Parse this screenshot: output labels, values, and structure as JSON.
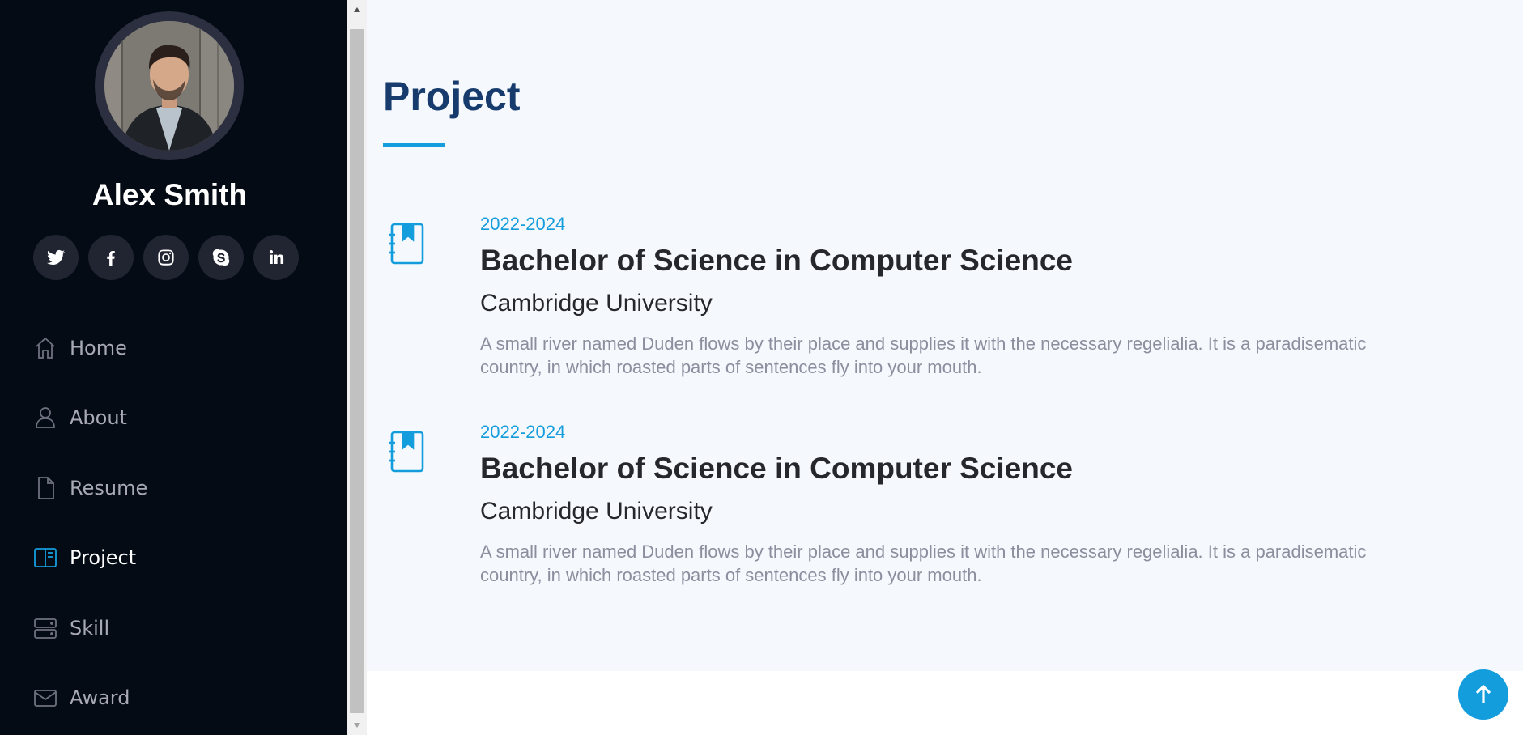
{
  "profile": {
    "name": "Alex Smith"
  },
  "social": [
    {
      "icon": "twitter-icon"
    },
    {
      "icon": "facebook-icon"
    },
    {
      "icon": "instagram-icon"
    },
    {
      "icon": "skype-icon"
    },
    {
      "icon": "linkedin-icon"
    }
  ],
  "nav": {
    "items": [
      {
        "label": "Home",
        "icon": "home-icon"
      },
      {
        "label": "About",
        "icon": "person-icon"
      },
      {
        "label": "Resume",
        "icon": "file-icon"
      },
      {
        "label": "Project",
        "icon": "layout-icon",
        "active": true
      },
      {
        "label": "Skill",
        "icon": "server-icon"
      },
      {
        "label": "Award",
        "icon": "envelope-icon"
      }
    ]
  },
  "section": {
    "title": "Project"
  },
  "entries": [
    {
      "date": "2022-2024",
      "degree": "Bachelor of Science in Computer Science",
      "school": "Cambridge University",
      "description": "A small river named Duden flows by their place and supplies it with the necessary regelialia. It is a paradisematic country, in which roasted parts of sentences fly into your mouth."
    },
    {
      "date": "2022-2024",
      "degree": "Bachelor of Science in Computer Science",
      "school": "Cambridge University",
      "description": "A small river named Duden flows by their place and supplies it with the necessary regelialia. It is a paradisematic country, in which roasted parts of sentences fly into your mouth."
    }
  ],
  "colors": {
    "sidebar_bg": "#040b14",
    "accent": "#149ddd",
    "title": "#173b6c",
    "main_bg": "#f5f8fd"
  }
}
